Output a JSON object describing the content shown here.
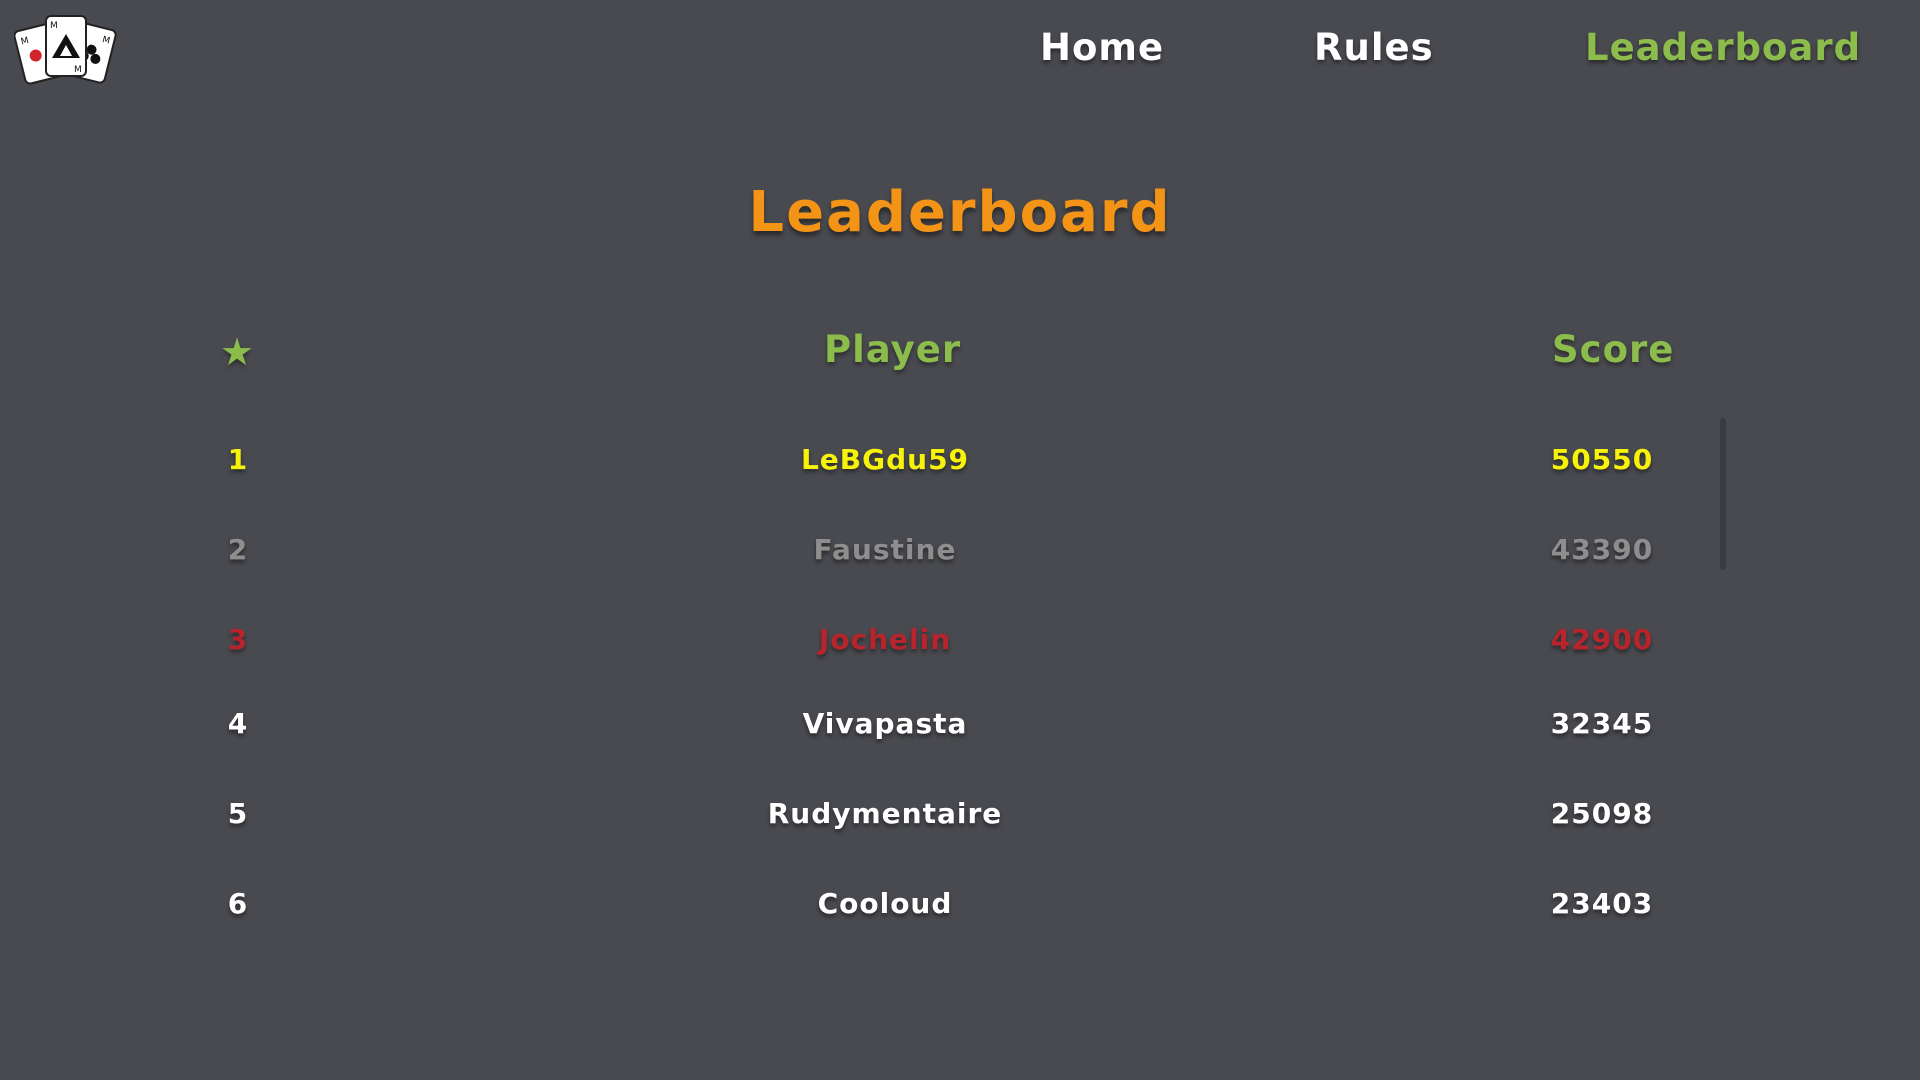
{
  "nav": {
    "logo_icon": "playing-cards-logo",
    "home_label": "Home",
    "rules_label": "Rules",
    "leaderboard_label": "Leaderboard"
  },
  "page": {
    "title": "Leaderboard"
  },
  "table": {
    "rank_header_icon": "star-icon",
    "rank_header": "★",
    "player_header": "Player",
    "score_header": "Score",
    "rows": [
      {
        "rank": "1",
        "player": "LeBGdu59",
        "score": "50550",
        "color": "#f6f20a"
      },
      {
        "rank": "2",
        "player": "Faustine",
        "score": "43390",
        "color": "#8e8e8e"
      },
      {
        "rank": "3",
        "player": "Jochelin",
        "score": "42900",
        "color": "#b8242b"
      },
      {
        "rank": "4",
        "player": "Vivapasta",
        "score": "32345",
        "color": "#ffffff"
      },
      {
        "rank": "5",
        "player": "Rudymentaire",
        "score": "25098",
        "color": "#ffffff"
      },
      {
        "rank": "6",
        "player": "Cooloud",
        "score": "23403",
        "color": "#ffffff"
      }
    ]
  },
  "colors": {
    "background": "#494a4f",
    "accent_green": "#8cbd4c",
    "title_orange": "#f39417"
  }
}
